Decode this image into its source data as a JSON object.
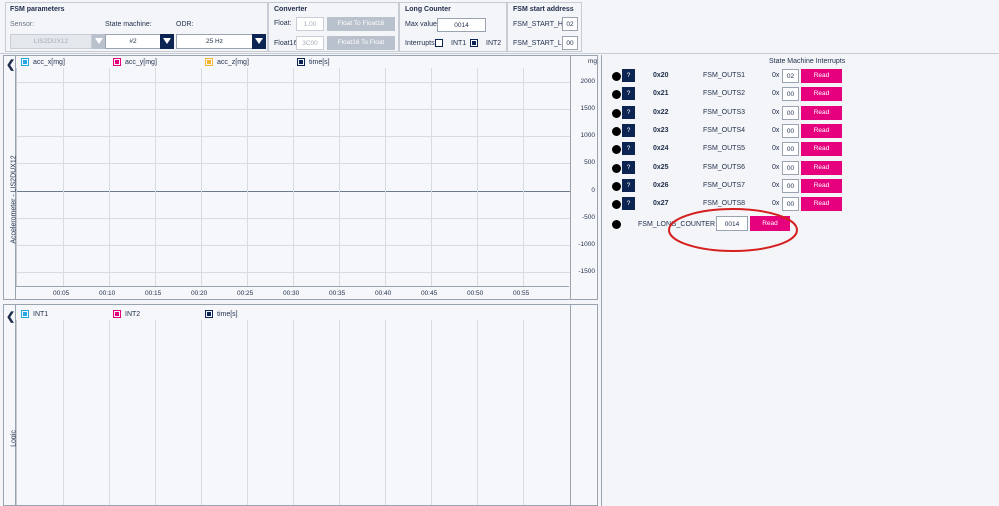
{
  "fsm_parameters": {
    "title": "FSM parameters",
    "sensor_label": "Sensor:",
    "sensor_value": "LIS2DUX12",
    "state_machine_label": "State machine:",
    "state_machine_value": "#2",
    "odr_label": "ODR:",
    "odr_value": "25 Hz"
  },
  "converter": {
    "title": "Converter",
    "float_label": "Float:",
    "float_value": "1.00",
    "float_to_f16_button": "Float To Float16",
    "float16_label": "Float16:",
    "float16_value": "3C00",
    "f16_to_float_button": "Float16 To Float"
  },
  "long_counter": {
    "title": "Long Counter",
    "max_value_label": "Max value",
    "max_value": "0014",
    "interrupts_label": "Interrupts:",
    "int1_label": "INT1",
    "int1_checked": false,
    "int2_label": "INT2",
    "int2_checked": true
  },
  "fsm_start": {
    "title": "FSM start address",
    "start_h_label": "FSM_START_H:",
    "start_h_value": "02",
    "start_l_label": "FSM_START_L:",
    "start_l_value": "00"
  },
  "accel_chart": {
    "side_label": "Accelerometer - LIS2DUX12",
    "unit": "mg",
    "legend": [
      {
        "name": "acc_x[mg]",
        "color": "#2aa6e0"
      },
      {
        "name": "acc_y[mg]",
        "color": "#e6007e"
      },
      {
        "name": "acc_z[mg]",
        "color": "#f2b631"
      },
      {
        "name": "time[s]",
        "color": "#0b2452"
      }
    ]
  },
  "logic_chart": {
    "side_label": "Logic",
    "legend": [
      {
        "name": "INT1",
        "color": "#2aa6e0"
      },
      {
        "name": "INT2",
        "color": "#e6007e"
      },
      {
        "name": "time[s]",
        "color": "#0b2452"
      }
    ]
  },
  "chart_data": {
    "type": "line",
    "xlabel": "",
    "ylabel": "mg",
    "ylim": [
      -1750,
      2250
    ],
    "y_ticks": [
      2000,
      1500,
      1000,
      500,
      0,
      -500,
      -1000,
      -1500
    ],
    "x_ticks": [
      "00:05",
      "00:10",
      "00:15",
      "00:20",
      "00:25",
      "00:30",
      "00:35",
      "00:40",
      "00:45",
      "00:50",
      "00:55"
    ],
    "series": [
      {
        "name": "acc_x[mg]",
        "values": []
      },
      {
        "name": "acc_y[mg]",
        "values": []
      },
      {
        "name": "acc_z[mg]",
        "values": []
      }
    ]
  },
  "interrupts": {
    "title": "State Machine Interrupts",
    "question_label": "?",
    "prefix": "0x",
    "read_label": "Read",
    "rows": [
      {
        "addr": "0x20",
        "name": "FSM_OUTS1",
        "value": "02"
      },
      {
        "addr": "0x21",
        "name": "FSM_OUTS2",
        "value": "00"
      },
      {
        "addr": "0x22",
        "name": "FSM_OUTS3",
        "value": "00"
      },
      {
        "addr": "0x23",
        "name": "FSM_OUTS4",
        "value": "00"
      },
      {
        "addr": "0x24",
        "name": "FSM_OUTS5",
        "value": "00"
      },
      {
        "addr": "0x25",
        "name": "FSM_OUTS6",
        "value": "00"
      },
      {
        "addr": "0x26",
        "name": "FSM_OUTS7",
        "value": "00"
      },
      {
        "addr": "0x27",
        "name": "FSM_OUTS8",
        "value": "00"
      }
    ],
    "long_counter_label": "FSM_LONG_COUNTER",
    "long_counter_value": "0014"
  }
}
